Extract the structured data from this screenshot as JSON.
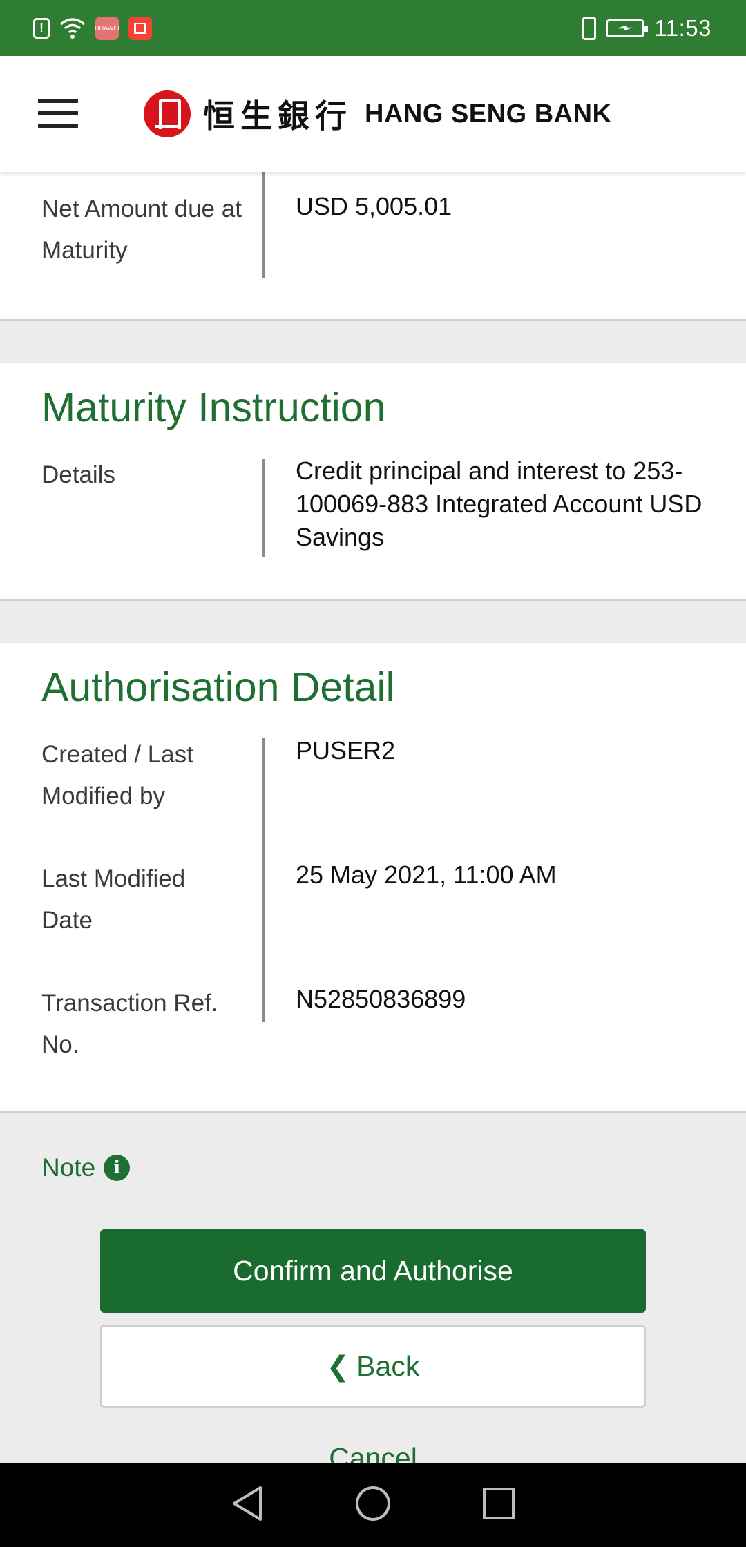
{
  "status_bar": {
    "alert_icon": "!",
    "app_badge_text": "HUAWEI",
    "time": "11:53"
  },
  "header": {
    "brand_cn": "恒生銀行",
    "brand_en": "HANG SENG BANK"
  },
  "net_amount": {
    "label": "Net Amount due at Maturity",
    "value": "USD 5,005.01"
  },
  "maturity_instruction": {
    "title": "Maturity Instruction",
    "details_label": "Details",
    "details_value": "Credit principal and interest to 253-100069-883 Integrated Account USD Savings"
  },
  "authorisation": {
    "title": "Authorisation Detail",
    "rows": [
      {
        "label": "Created / Last Modified by",
        "value": "PUSER2"
      },
      {
        "label": "Last Modified Date",
        "value": "25 May 2021, 11:00 AM"
      },
      {
        "label": "Transaction Ref. No.",
        "value": "N52850836899"
      }
    ]
  },
  "note": {
    "label": "Note",
    "icon": "i"
  },
  "actions": {
    "confirm_label": "Confirm and Authorise",
    "back_label": "Back",
    "back_icon": "❮",
    "cancel_label": "Cancel"
  },
  "colors": {
    "brand_green": "#1f6f32",
    "status_green": "#2e7d32",
    "logo_red": "#d7141a"
  }
}
